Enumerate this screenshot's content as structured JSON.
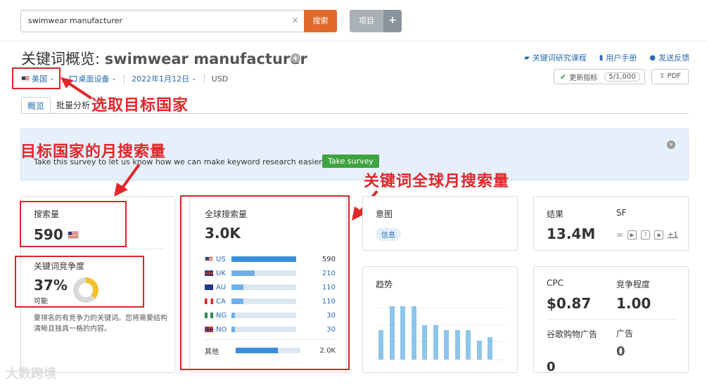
{
  "search": {
    "value": "swimwear manufacturer",
    "clear": "×",
    "button": "搜索"
  },
  "project": {
    "label": "项目",
    "plus": "+"
  },
  "title": {
    "prefix": "关键词概览: ",
    "keyword": "swimwear manufacturer",
    "plus": "+"
  },
  "toplinks": [
    {
      "icon": "graduation-cap-icon",
      "label": "关键词研究课程"
    },
    {
      "icon": "book-icon",
      "label": "用户手册"
    },
    {
      "icon": "chat-bubble-icon",
      "label": "发送反馈"
    }
  ],
  "update": {
    "check": "✔",
    "label": "更新指标",
    "count": "5/1,000"
  },
  "pdf": {
    "icon": "⇪",
    "label": "PDF"
  },
  "filters": {
    "country": "美国",
    "device": "桌面设备",
    "date": "2022年1月12日",
    "currency": "USD",
    "chevron": "⌄"
  },
  "tabs": [
    {
      "label": "概览"
    },
    {
      "label": "批量分析"
    }
  ],
  "annotations": {
    "select_country": "选取目标国家",
    "country_monthly": "目标国家的月搜索量",
    "global_monthly": "关键词全球月搜索量"
  },
  "survey": {
    "text": "Take this survey to let us know how we can make keyword research easier for you.",
    "button": "Take survey",
    "close": "×"
  },
  "volume": {
    "label": "搜索量",
    "value": "590"
  },
  "difficulty": {
    "label": "关键词竞争度",
    "value": "37%",
    "level": "可能",
    "fraction": 0.37,
    "note": "要排名的有竞争力的关键词。您将需要结构清晰且独具一格的内容。"
  },
  "global": {
    "label": "全球搜索量",
    "value": "3.0K",
    "countries": [
      {
        "code": "US",
        "value": "590",
        "share": 1.0
      },
      {
        "code": "UK",
        "value": "210",
        "share": 0.36
      },
      {
        "code": "AU",
        "value": "110",
        "share": 0.19
      },
      {
        "code": "CA",
        "value": "110",
        "share": 0.19
      },
      {
        "code": "NG",
        "value": "30",
        "share": 0.05
      },
      {
        "code": "NO",
        "value": "30",
        "share": 0.05
      }
    ],
    "other": {
      "label": "其他",
      "value": "2.0K",
      "share": 0.65
    }
  },
  "intent": {
    "label": "意图",
    "badge": "信息"
  },
  "results": {
    "label": "结果",
    "value": "13.4M",
    "sf_label": "SF",
    "sf_more": "+1"
  },
  "trend": {
    "label": "趋势",
    "values": [
      0.55,
      1.0,
      1.0,
      1.0,
      0.65,
      0.65,
      0.55,
      0.55,
      0.55,
      0.35,
      0.42
    ]
  },
  "cpc": {
    "label": "CPC",
    "value": "$0.87"
  },
  "competition": {
    "label": "竞争程度",
    "value": "1.00"
  },
  "shopping": {
    "label": "谷歌购物广告",
    "value": "0"
  },
  "ads": {
    "label": "广告",
    "value": "0"
  },
  "watermark": "大数跨境"
}
